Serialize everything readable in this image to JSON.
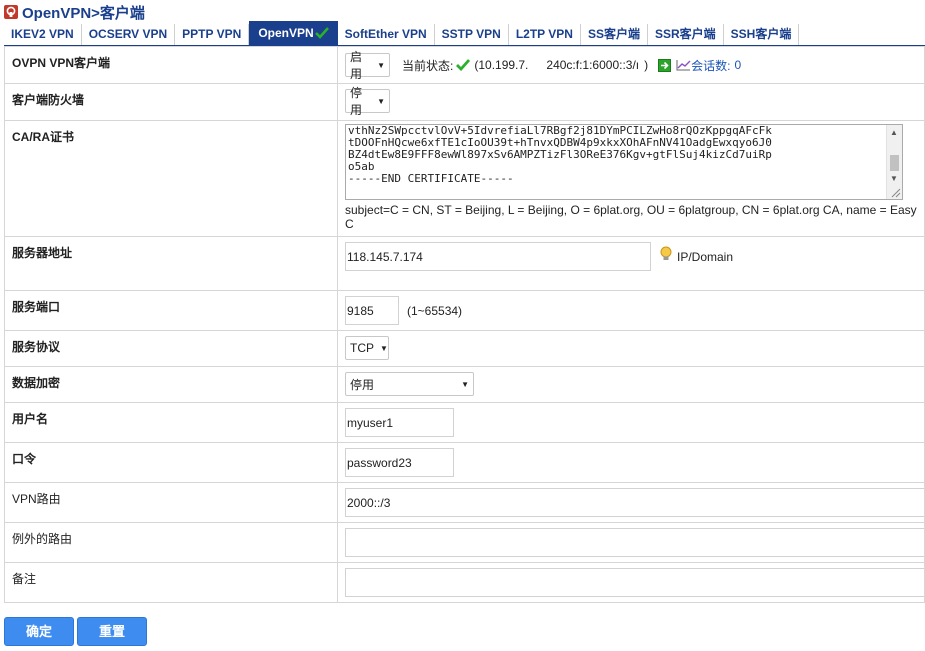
{
  "header": {
    "title": "OpenVPN>客户端"
  },
  "tabs": [
    {
      "label": "IKEV2 VPN"
    },
    {
      "label": "OCSERV VPN"
    },
    {
      "label": "PPTP VPN"
    },
    {
      "label": "OpenVPN",
      "active": true
    },
    {
      "label": "SoftEther VPN"
    },
    {
      "label": "SSTP VPN"
    },
    {
      "label": "L2TP VPN"
    },
    {
      "label": "SS客户端"
    },
    {
      "label": "SSR客户端"
    },
    {
      "label": "SSH客户端"
    }
  ],
  "form": {
    "client": {
      "label": "OVPN VPN客户端",
      "select_value": "启用",
      "status_label": "当前状态:",
      "status_open": "(10.199.7.",
      "status_ipv6": "240c:f:1:6000::3/ı",
      "status_close": ")",
      "sessions_label": "会话数:",
      "sessions_count": "0"
    },
    "firewall": {
      "label": "客户端防火墙",
      "select_value": "停用"
    },
    "cert": {
      "label": "CA/RA证书",
      "text": "vthNz2SWpcctvlOvV+5IdvrefiaLl7RBgf2j81DYmPCILZwHo8rQOzKppgqAFcFk\ntDOOFnHQcwe6xfTE1cIoOU39t+hTnvxQDBW4p9xkxXOhAFnNV41OadgEwxqyo6J0\nBZ4dtEw8E9FFF8ewWl897xSv6AMPZTizFl3OReE376Kgv+gtFlSuj4kizCd7uiRp\no5ab\n-----END CERTIFICATE-----",
      "subject_line1": "subject=C = CN, ST = Beijing, L = Beijing, O = 6plat.org, OU = 6platgroup, CN = 6plat.org CA, name = Easy",
      "subject_line2": "C"
    },
    "server": {
      "label": "服务器地址",
      "value": "118.145.7.174",
      "hint": "IP/Domain"
    },
    "port": {
      "label": "服务端口",
      "value": "9185",
      "hint": "(1~65534)"
    },
    "protocol": {
      "label": "服务协议",
      "select_value": "TCP"
    },
    "encryption": {
      "label": "数据加密",
      "select_value": "停用"
    },
    "username": {
      "label": "用户名",
      "value": "myuser1"
    },
    "password": {
      "label": "口令",
      "value": "password23"
    },
    "route": {
      "label": "VPN路由",
      "value": "2000::/3"
    },
    "except_route": {
      "label": "例外的路由",
      "value": ""
    },
    "note": {
      "label": "备注",
      "value": ""
    }
  },
  "buttons": {
    "confirm": "确定",
    "reset": "重置"
  },
  "colors": {
    "brand": "#1a3f8c",
    "button": "#3f8cf0",
    "check": "#2ab02a"
  }
}
